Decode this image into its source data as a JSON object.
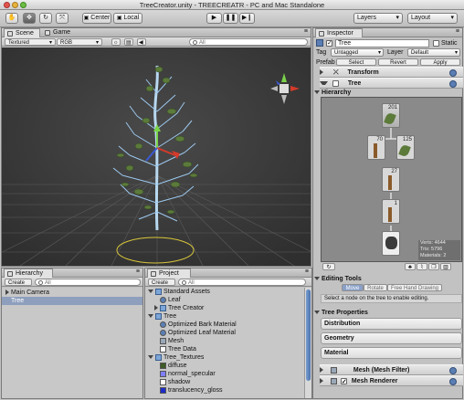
{
  "window": {
    "title": "TreeCreator.unity - TREECREATR - PC and Mac Standalone"
  },
  "toolbar": {
    "center_label": "Center",
    "local_label": "Local",
    "layers_label": "Layers",
    "layout_label": "Layout"
  },
  "scene": {
    "tabs": [
      "Scene",
      "Game"
    ],
    "shading_value": "Textured",
    "render_value": "RGB",
    "search_placeholder": "All"
  },
  "hierarchy": {
    "tab": "Hierarchy",
    "create_label": "Create",
    "search_placeholder": "All",
    "items": [
      "Main Camera",
      "Tree"
    ]
  },
  "project": {
    "tab": "Project",
    "create_label": "Create",
    "search_placeholder": "All",
    "items": [
      {
        "label": "Standard Assets",
        "depth": 0,
        "kind": "folder-open"
      },
      {
        "label": "Leaf",
        "depth": 1,
        "kind": "sphere"
      },
      {
        "label": "Tree Creator",
        "depth": 1,
        "kind": "folder"
      },
      {
        "label": "Tree",
        "depth": 0,
        "kind": "folder-open"
      },
      {
        "label": "Optimized Bark Material",
        "depth": 1,
        "kind": "sphere"
      },
      {
        "label": "Optimized Leaf Material",
        "depth": 1,
        "kind": "sphere"
      },
      {
        "label": "Mesh",
        "depth": 1,
        "kind": "mesh"
      },
      {
        "label": "Tree Data",
        "depth": 1,
        "kind": "file"
      },
      {
        "label": "Tree_Textures",
        "depth": 0,
        "kind": "folder-open"
      },
      {
        "label": "diffuse",
        "depth": 1,
        "kind": "tex-diffuse"
      },
      {
        "label": "normal_specular",
        "depth": 1,
        "kind": "tex-normal"
      },
      {
        "label": "shadow",
        "depth": 1,
        "kind": "tex-shadow"
      },
      {
        "label": "translucency_gloss",
        "depth": 1,
        "kind": "tex-trans"
      }
    ]
  },
  "inspector": {
    "tab": "Inspector",
    "object_name": "Tree",
    "static_label": "Static",
    "tag_label": "Tag",
    "tag_value": "Untagged",
    "layer_label": "Layer",
    "layer_value": "Default",
    "prefab_label": "Prefab",
    "prefab_buttons": [
      "Select",
      "Revert",
      "Apply"
    ],
    "transform_label": "Transform",
    "tree_label": "Tree",
    "hierarchy_label": "Hierarchy",
    "nodes": [
      "201",
      "70",
      "125",
      "27",
      "1"
    ],
    "stats": {
      "verts": "Verts: 4644",
      "tris": "Tris: 5796",
      "materials": "Materials: 2"
    },
    "editing_tools_label": "Editing Tools",
    "edit_buttons": [
      "Move",
      "Rotate",
      "Free Hand Drawing"
    ],
    "edit_hint": "Select a node on the tree to enable editing.",
    "tree_properties_label": "Tree Properties",
    "properties": [
      "Distribution",
      "Geometry",
      "Material"
    ],
    "components": [
      "Mesh  (Mesh Filter)",
      "Mesh Renderer"
    ]
  },
  "colors": {
    "accent": "#5b7fb4",
    "scene_bg": "#3b3b3b",
    "selection": "#8e9fbd"
  }
}
